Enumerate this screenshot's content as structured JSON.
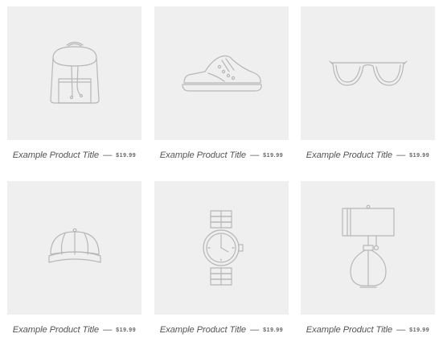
{
  "colors": {
    "tile_background": "#efefef",
    "text": "#555555",
    "icon_stroke": "#b7b7b7"
  },
  "products": [
    {
      "title": "Example Product Title",
      "separator": "—",
      "price": "$19.99",
      "icon": "backpack-icon"
    },
    {
      "title": "Example Product Title",
      "separator": "—",
      "price": "$19.99",
      "icon": "sneaker-icon"
    },
    {
      "title": "Example Product Title",
      "separator": "—",
      "price": "$19.99",
      "icon": "glasses-icon"
    },
    {
      "title": "Example Product Title",
      "separator": "—",
      "price": "$19.99",
      "icon": "cap-icon"
    },
    {
      "title": "Example Product Title",
      "separator": "—",
      "price": "$19.99",
      "icon": "watch-icon"
    },
    {
      "title": "Example Product Title",
      "separator": "—",
      "price": "$19.99",
      "icon": "lamp-icon"
    }
  ]
}
